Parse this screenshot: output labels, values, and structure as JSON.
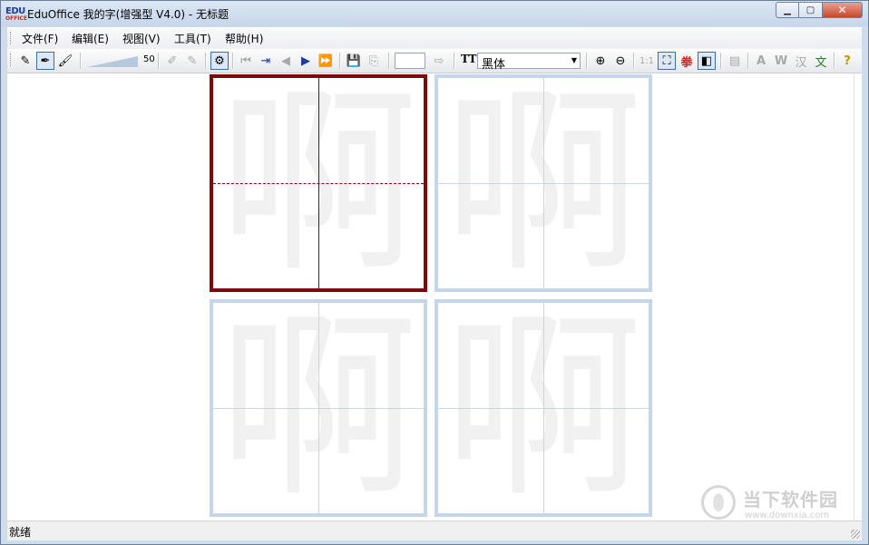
{
  "window": {
    "title": "EduOffice 我的字(增强型 V4.0) - 无标题"
  },
  "app_logo": {
    "line1": "EDU",
    "line2": "OFFICE"
  },
  "window_buttons": {
    "minimize": "▁",
    "maximize": "▢",
    "close": "✕"
  },
  "menu": {
    "items": [
      {
        "label": "文件(F)"
      },
      {
        "label": "编辑(E)"
      },
      {
        "label": "视图(V)"
      },
      {
        "label": "工具(T)"
      },
      {
        "label": "帮助(H)"
      }
    ]
  },
  "toolbar": {
    "slider_value": "50",
    "page_number": "",
    "font_icon": "TT",
    "font_name": "黑体",
    "zoom_1to1": "1:1",
    "btn_fan": "拳",
    "btn_a": "A",
    "btn_w": "W",
    "btn_han": "汉",
    "btn_wen": "文",
    "btn_help": "?"
  },
  "canvas": {
    "character": "啊",
    "cells": [
      {
        "glyph": "啊",
        "active": true
      },
      {
        "glyph": "啊",
        "active": false
      },
      {
        "glyph": "啊",
        "active": false
      },
      {
        "glyph": "啊",
        "active": false
      }
    ],
    "active_border_color": "#7b0a0a",
    "grid_color": "#c5d5ea"
  },
  "status": {
    "text": "就绪"
  },
  "watermark": {
    "brand": "当下软件园",
    "url": "www.downxia.com"
  }
}
